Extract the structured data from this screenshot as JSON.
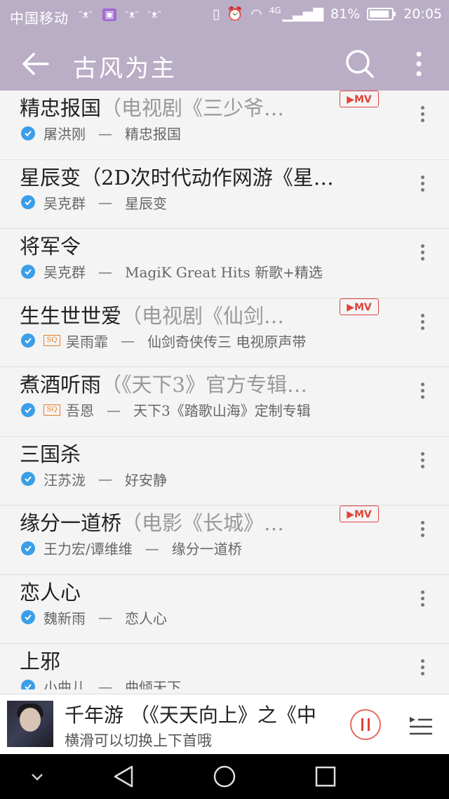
{
  "status_bar": {
    "carrier": "中国移动",
    "network": "4G",
    "battery": "81%",
    "time": "20:05"
  },
  "app_bar": {
    "title": "古风为主"
  },
  "songs": [
    {
      "title": "精忠报国",
      "extra": "（电视剧《三少爷…",
      "mv": true,
      "mv_label": "▶MV",
      "sq": false,
      "artist": "屠洪刚",
      "sep": "—",
      "album": "精忠报国"
    },
    {
      "title": "星辰变（2D次时代动作网游《星…",
      "extra": "",
      "mv": false,
      "sq": false,
      "artist": "吴克群",
      "sep": "—",
      "album": "星辰变"
    },
    {
      "title": "将军令",
      "extra": "",
      "mv": false,
      "sq": false,
      "artist": "吴克群",
      "sep": "—",
      "album": "MagiK Great Hits 新歌+精选"
    },
    {
      "title": "生生世世爱",
      "extra": "（电视剧《仙剑…",
      "mv": true,
      "mv_label": "▶MV",
      "sq": true,
      "sq_label": "SQ",
      "artist": "吴雨霏",
      "sep": "—",
      "album": "仙剑奇侠传三 电视原声带"
    },
    {
      "title": "煮酒听雨",
      "extra": "（《天下3》官方专辑…",
      "mv": false,
      "sq": true,
      "sq_label": "SQ",
      "artist": "吾恩",
      "sep": "—",
      "album": "天下3《踏歌山海》定制专辑"
    },
    {
      "title": "三国杀",
      "extra": "",
      "mv": false,
      "sq": false,
      "artist": "汪苏泷",
      "sep": "—",
      "album": "好安静"
    },
    {
      "title": "缘分一道桥",
      "extra": "（电影《长城》…",
      "mv": true,
      "mv_label": "▶MV",
      "sq": false,
      "artist": "王力宏/谭维维",
      "sep": "—",
      "album": "缘分一道桥"
    },
    {
      "title": "恋人心",
      "extra": "",
      "mv": false,
      "sq": false,
      "artist": "魏新雨",
      "sep": "—",
      "album": "恋人心"
    },
    {
      "title": "上邪",
      "extra": "",
      "mv": false,
      "sq": false,
      "artist": "小曲儿",
      "sep": "—",
      "album": "曲倾天下"
    }
  ],
  "player": {
    "song": "千年游 （《天天向上》之《中",
    "hint": "横滑可以切换上下首哦"
  },
  "colors": {
    "app_bar": "#b9aec6",
    "check": "#3a9ee8",
    "mv": "#e0433a",
    "sq": "#e67e22"
  }
}
